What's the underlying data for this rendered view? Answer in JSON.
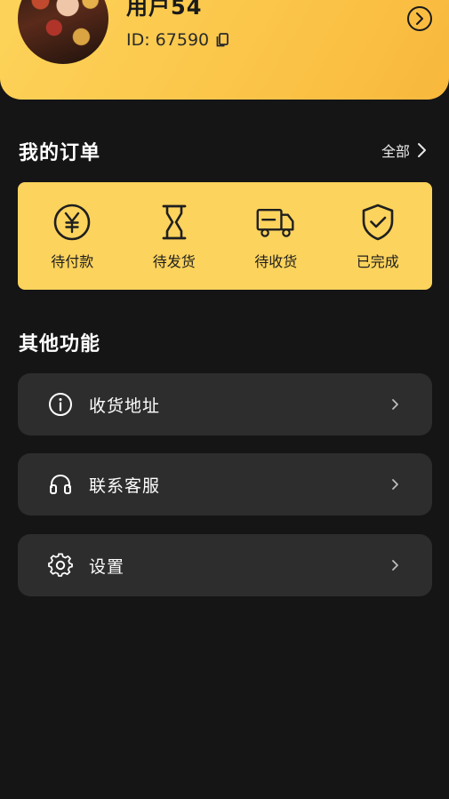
{
  "profile": {
    "username": "用户54",
    "user_id": "ID: 67590"
  },
  "orders": {
    "title": "我的订单",
    "see_all": "全部",
    "items": [
      {
        "label": "待付款",
        "icon": "yen-circle-icon"
      },
      {
        "label": "待发货",
        "icon": "hourglass-icon"
      },
      {
        "label": "待收货",
        "icon": "delivery-truck-icon"
      },
      {
        "label": "已完成",
        "icon": "shield-check-icon"
      }
    ]
  },
  "other": {
    "title": "其他功能",
    "items": [
      {
        "label": "收货地址",
        "icon": "info-circle-icon"
      },
      {
        "label": "联系客服",
        "icon": "headphones-icon"
      },
      {
        "label": "设置",
        "icon": "gear-icon"
      }
    ]
  },
  "colors": {
    "background": "#151515",
    "accent": "#fcd35c",
    "row_background": "#2d2d2d"
  }
}
